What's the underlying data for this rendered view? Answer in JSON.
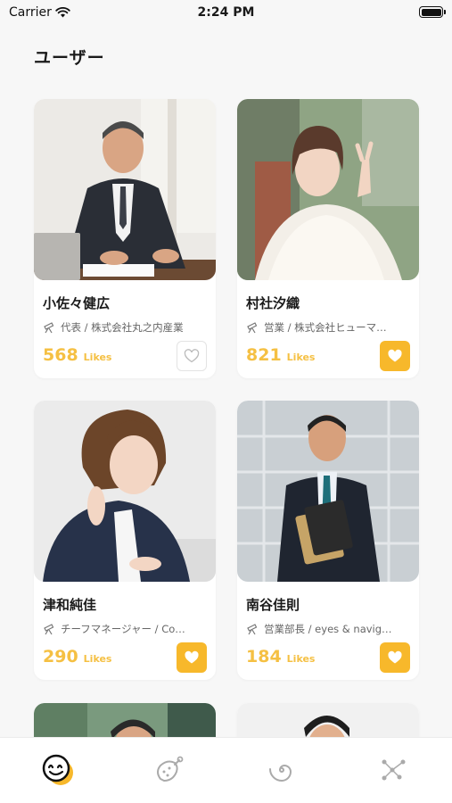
{
  "status": {
    "carrier": "Carrier",
    "time": "2:24 PM"
  },
  "header": {
    "title": "ユーザー"
  },
  "likes_unit": "Likes",
  "colors": {
    "accent": "#f7b82b",
    "likes_text": "#f5c043"
  },
  "users": [
    {
      "name": "小佐々健広",
      "role": "代表 / 株式会社丸之内産業",
      "likes": "568",
      "liked": false
    },
    {
      "name": "村社汐織",
      "role": "営業 / 株式会社ヒューマ…",
      "likes": "821",
      "liked": true
    },
    {
      "name": "津和純佳",
      "role": "チーフマネージャー / Co…",
      "likes": "290",
      "liked": true
    },
    {
      "name": "南谷佳則",
      "role": "営業部長 / eyes & navig…",
      "likes": "184",
      "liked": true
    }
  ],
  "tabs": [
    {
      "icon": "face-logo-icon",
      "active": true
    },
    {
      "icon": "meat-icon",
      "active": false
    },
    {
      "icon": "spiral-icon",
      "active": false
    },
    {
      "icon": "constellation-icon",
      "active": false
    }
  ]
}
